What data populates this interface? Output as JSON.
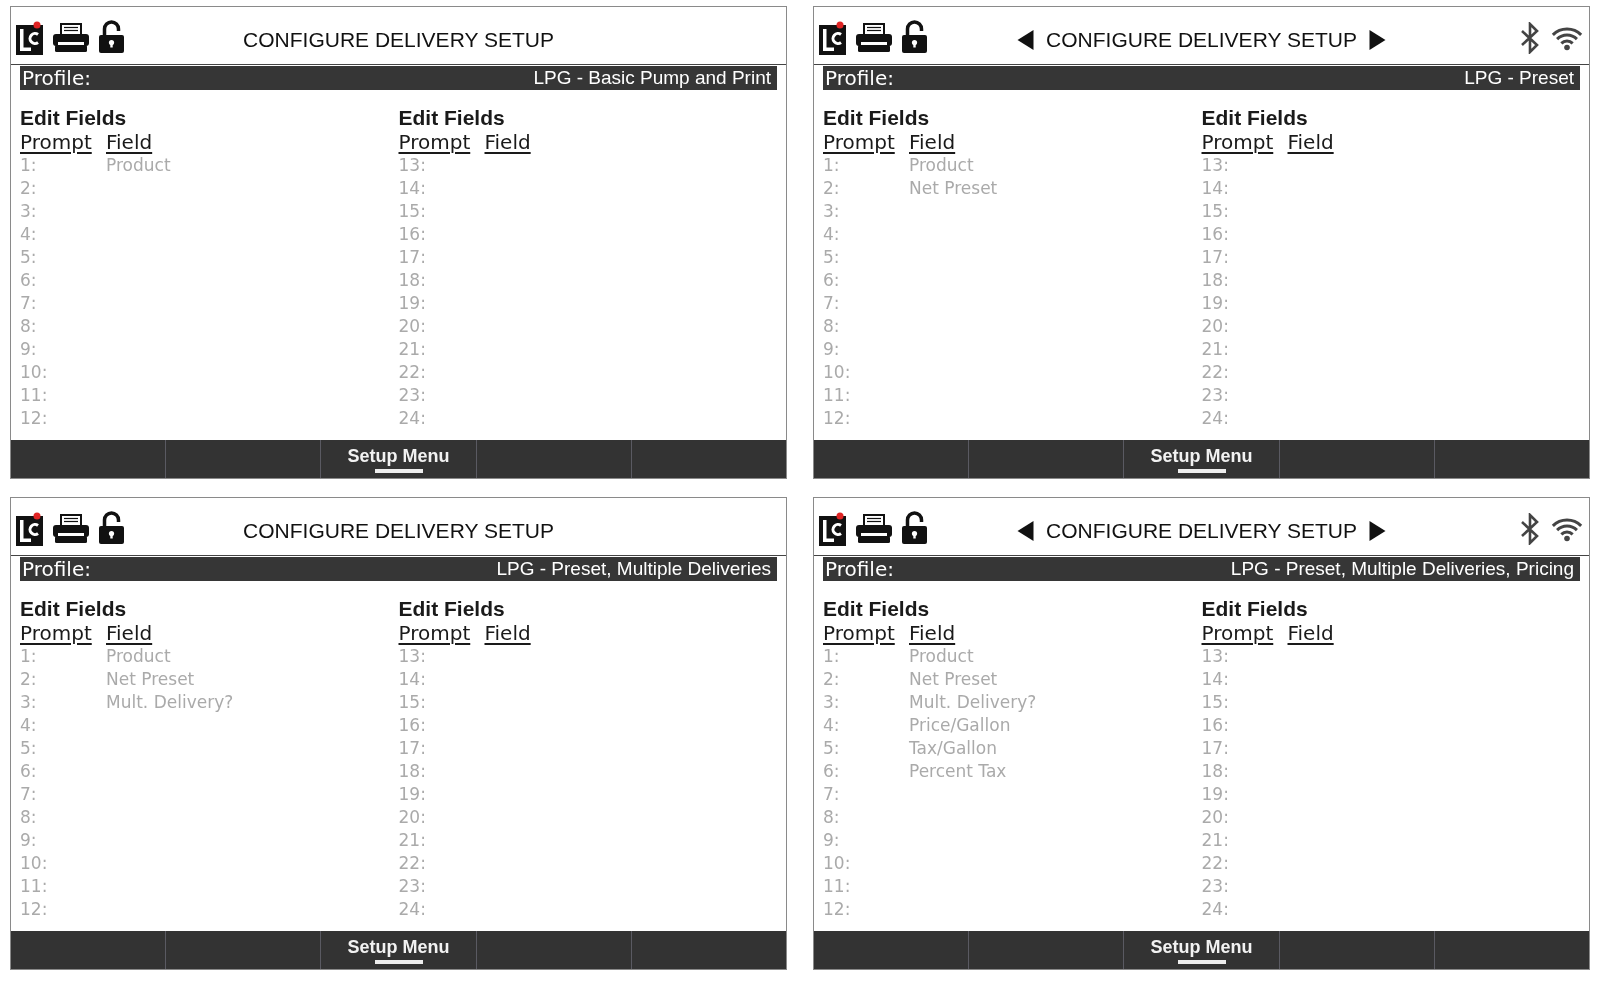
{
  "screens": [
    {
      "header": {
        "title": "CONFIGURE DELIVERY SETUP",
        "page_arrows": false,
        "bluetooth": false,
        "wifi": false
      },
      "profile": {
        "label": "Profile:",
        "value": "LPG - Basic Pump and Print"
      },
      "columns": [
        {
          "heading": "Edit Fields",
          "prompt_heading": "Prompt",
          "field_heading": "Field",
          "rows": [
            {
              "prompt": "1:",
              "field": "Product"
            },
            {
              "prompt": "2:"
            },
            {
              "prompt": "3:"
            },
            {
              "prompt": "4:"
            },
            {
              "prompt": "5:"
            },
            {
              "prompt": "6:"
            },
            {
              "prompt": "7:"
            },
            {
              "prompt": "8:"
            },
            {
              "prompt": "9:"
            },
            {
              "prompt": "10:"
            },
            {
              "prompt": "11:"
            },
            {
              "prompt": "12:"
            }
          ]
        },
        {
          "heading": "Edit Fields",
          "prompt_heading": "Prompt",
          "field_heading": "Field",
          "rows": [
            {
              "prompt": "13:"
            },
            {
              "prompt": "14:"
            },
            {
              "prompt": "15:"
            },
            {
              "prompt": "16:"
            },
            {
              "prompt": "17:"
            },
            {
              "prompt": "18:"
            },
            {
              "prompt": "19:"
            },
            {
              "prompt": "20:"
            },
            {
              "prompt": "21:"
            },
            {
              "prompt": "22:"
            },
            {
              "prompt": "23:"
            },
            {
              "prompt": "24:"
            }
          ]
        }
      ],
      "softkeys": [
        {
          "selected": false
        },
        {
          "selected": false
        },
        {
          "label": "Setup Menu",
          "selected": true
        },
        {
          "selected": false
        },
        {
          "selected": false
        }
      ]
    },
    {
      "header": {
        "title": "CONFIGURE DELIVERY SETUP",
        "page_arrows": true,
        "bluetooth": true,
        "wifi": true
      },
      "profile": {
        "label": "Profile:",
        "value": "LPG - Preset"
      },
      "columns": [
        {
          "heading": "Edit Fields",
          "prompt_heading": "Prompt",
          "field_heading": "Field",
          "rows": [
            {
              "prompt": "1:",
              "field": "Product"
            },
            {
              "prompt": "2:",
              "field": "Net Preset"
            },
            {
              "prompt": "3:"
            },
            {
              "prompt": "4:"
            },
            {
              "prompt": "5:"
            },
            {
              "prompt": "6:"
            },
            {
              "prompt": "7:"
            },
            {
              "prompt": "8:"
            },
            {
              "prompt": "9:"
            },
            {
              "prompt": "10:"
            },
            {
              "prompt": "11:"
            },
            {
              "prompt": "12:"
            }
          ]
        },
        {
          "heading": "Edit Fields",
          "prompt_heading": "Prompt",
          "field_heading": "Field",
          "rows": [
            {
              "prompt": "13:"
            },
            {
              "prompt": "14:"
            },
            {
              "prompt": "15:"
            },
            {
              "prompt": "16:"
            },
            {
              "prompt": "17:"
            },
            {
              "prompt": "18:"
            },
            {
              "prompt": "19:"
            },
            {
              "prompt": "20:"
            },
            {
              "prompt": "21:"
            },
            {
              "prompt": "22:"
            },
            {
              "prompt": "23:"
            },
            {
              "prompt": "24:"
            }
          ]
        }
      ],
      "softkeys": [
        {
          "selected": false
        },
        {
          "selected": false
        },
        {
          "label": "Setup Menu",
          "selected": true
        },
        {
          "selected": false
        },
        {
          "selected": false
        }
      ]
    },
    {
      "header": {
        "title": "CONFIGURE DELIVERY SETUP",
        "page_arrows": false,
        "bluetooth": false,
        "wifi": false
      },
      "profile": {
        "label": "Profile:",
        "value": "LPG - Preset, Multiple Deliveries"
      },
      "columns": [
        {
          "heading": "Edit Fields",
          "prompt_heading": "Prompt",
          "field_heading": "Field",
          "rows": [
            {
              "prompt": "1:",
              "field": "Product"
            },
            {
              "prompt": "2:",
              "field": "Net Preset"
            },
            {
              "prompt": "3:",
              "field": "Mult. Delivery?"
            },
            {
              "prompt": "4:"
            },
            {
              "prompt": "5:"
            },
            {
              "prompt": "6:"
            },
            {
              "prompt": "7:"
            },
            {
              "prompt": "8:"
            },
            {
              "prompt": "9:"
            },
            {
              "prompt": "10:"
            },
            {
              "prompt": "11:"
            },
            {
              "prompt": "12:"
            }
          ]
        },
        {
          "heading": "Edit Fields",
          "prompt_heading": "Prompt",
          "field_heading": "Field",
          "rows": [
            {
              "prompt": "13:"
            },
            {
              "prompt": "14:"
            },
            {
              "prompt": "15:"
            },
            {
              "prompt": "16:"
            },
            {
              "prompt": "17:"
            },
            {
              "prompt": "18:"
            },
            {
              "prompt": "19:"
            },
            {
              "prompt": "20:"
            },
            {
              "prompt": "21:"
            },
            {
              "prompt": "22:"
            },
            {
              "prompt": "23:"
            },
            {
              "prompt": "24:"
            }
          ]
        }
      ],
      "softkeys": [
        {
          "selected": false
        },
        {
          "selected": false
        },
        {
          "label": "Setup Menu",
          "selected": true
        },
        {
          "selected": false
        },
        {
          "selected": false
        }
      ]
    },
    {
      "header": {
        "title": "CONFIGURE DELIVERY SETUP",
        "page_arrows": true,
        "bluetooth": true,
        "wifi": true
      },
      "profile": {
        "label": "Profile:",
        "value": "LPG - Preset, Multiple Deliveries, Pricing"
      },
      "columns": [
        {
          "heading": "Edit Fields",
          "prompt_heading": "Prompt",
          "field_heading": "Field",
          "rows": [
            {
              "prompt": "1:",
              "field": "Product"
            },
            {
              "prompt": "2:",
              "field": "Net Preset"
            },
            {
              "prompt": "3:",
              "field": "Mult. Delivery?"
            },
            {
              "prompt": "4:",
              "field": "Price/Gallon"
            },
            {
              "prompt": "5:",
              "field": "Tax/Gallon"
            },
            {
              "prompt": "6:",
              "field": "Percent Tax"
            },
            {
              "prompt": "7:"
            },
            {
              "prompt": "8:"
            },
            {
              "prompt": "9:"
            },
            {
              "prompt": "10:"
            },
            {
              "prompt": "11:"
            },
            {
              "prompt": "12:"
            }
          ]
        },
        {
          "heading": "Edit Fields",
          "prompt_heading": "Prompt",
          "field_heading": "Field",
          "rows": [
            {
              "prompt": "13:"
            },
            {
              "prompt": "14:"
            },
            {
              "prompt": "15:"
            },
            {
              "prompt": "16:"
            },
            {
              "prompt": "17:"
            },
            {
              "prompt": "18:"
            },
            {
              "prompt": "19:"
            },
            {
              "prompt": "20:"
            },
            {
              "prompt": "21:"
            },
            {
              "prompt": "22:"
            },
            {
              "prompt": "23:"
            },
            {
              "prompt": "24:"
            }
          ]
        }
      ],
      "softkeys": [
        {
          "selected": false
        },
        {
          "selected": false
        },
        {
          "label": "Setup Menu",
          "selected": true
        },
        {
          "selected": false
        },
        {
          "selected": false
        }
      ]
    }
  ]
}
